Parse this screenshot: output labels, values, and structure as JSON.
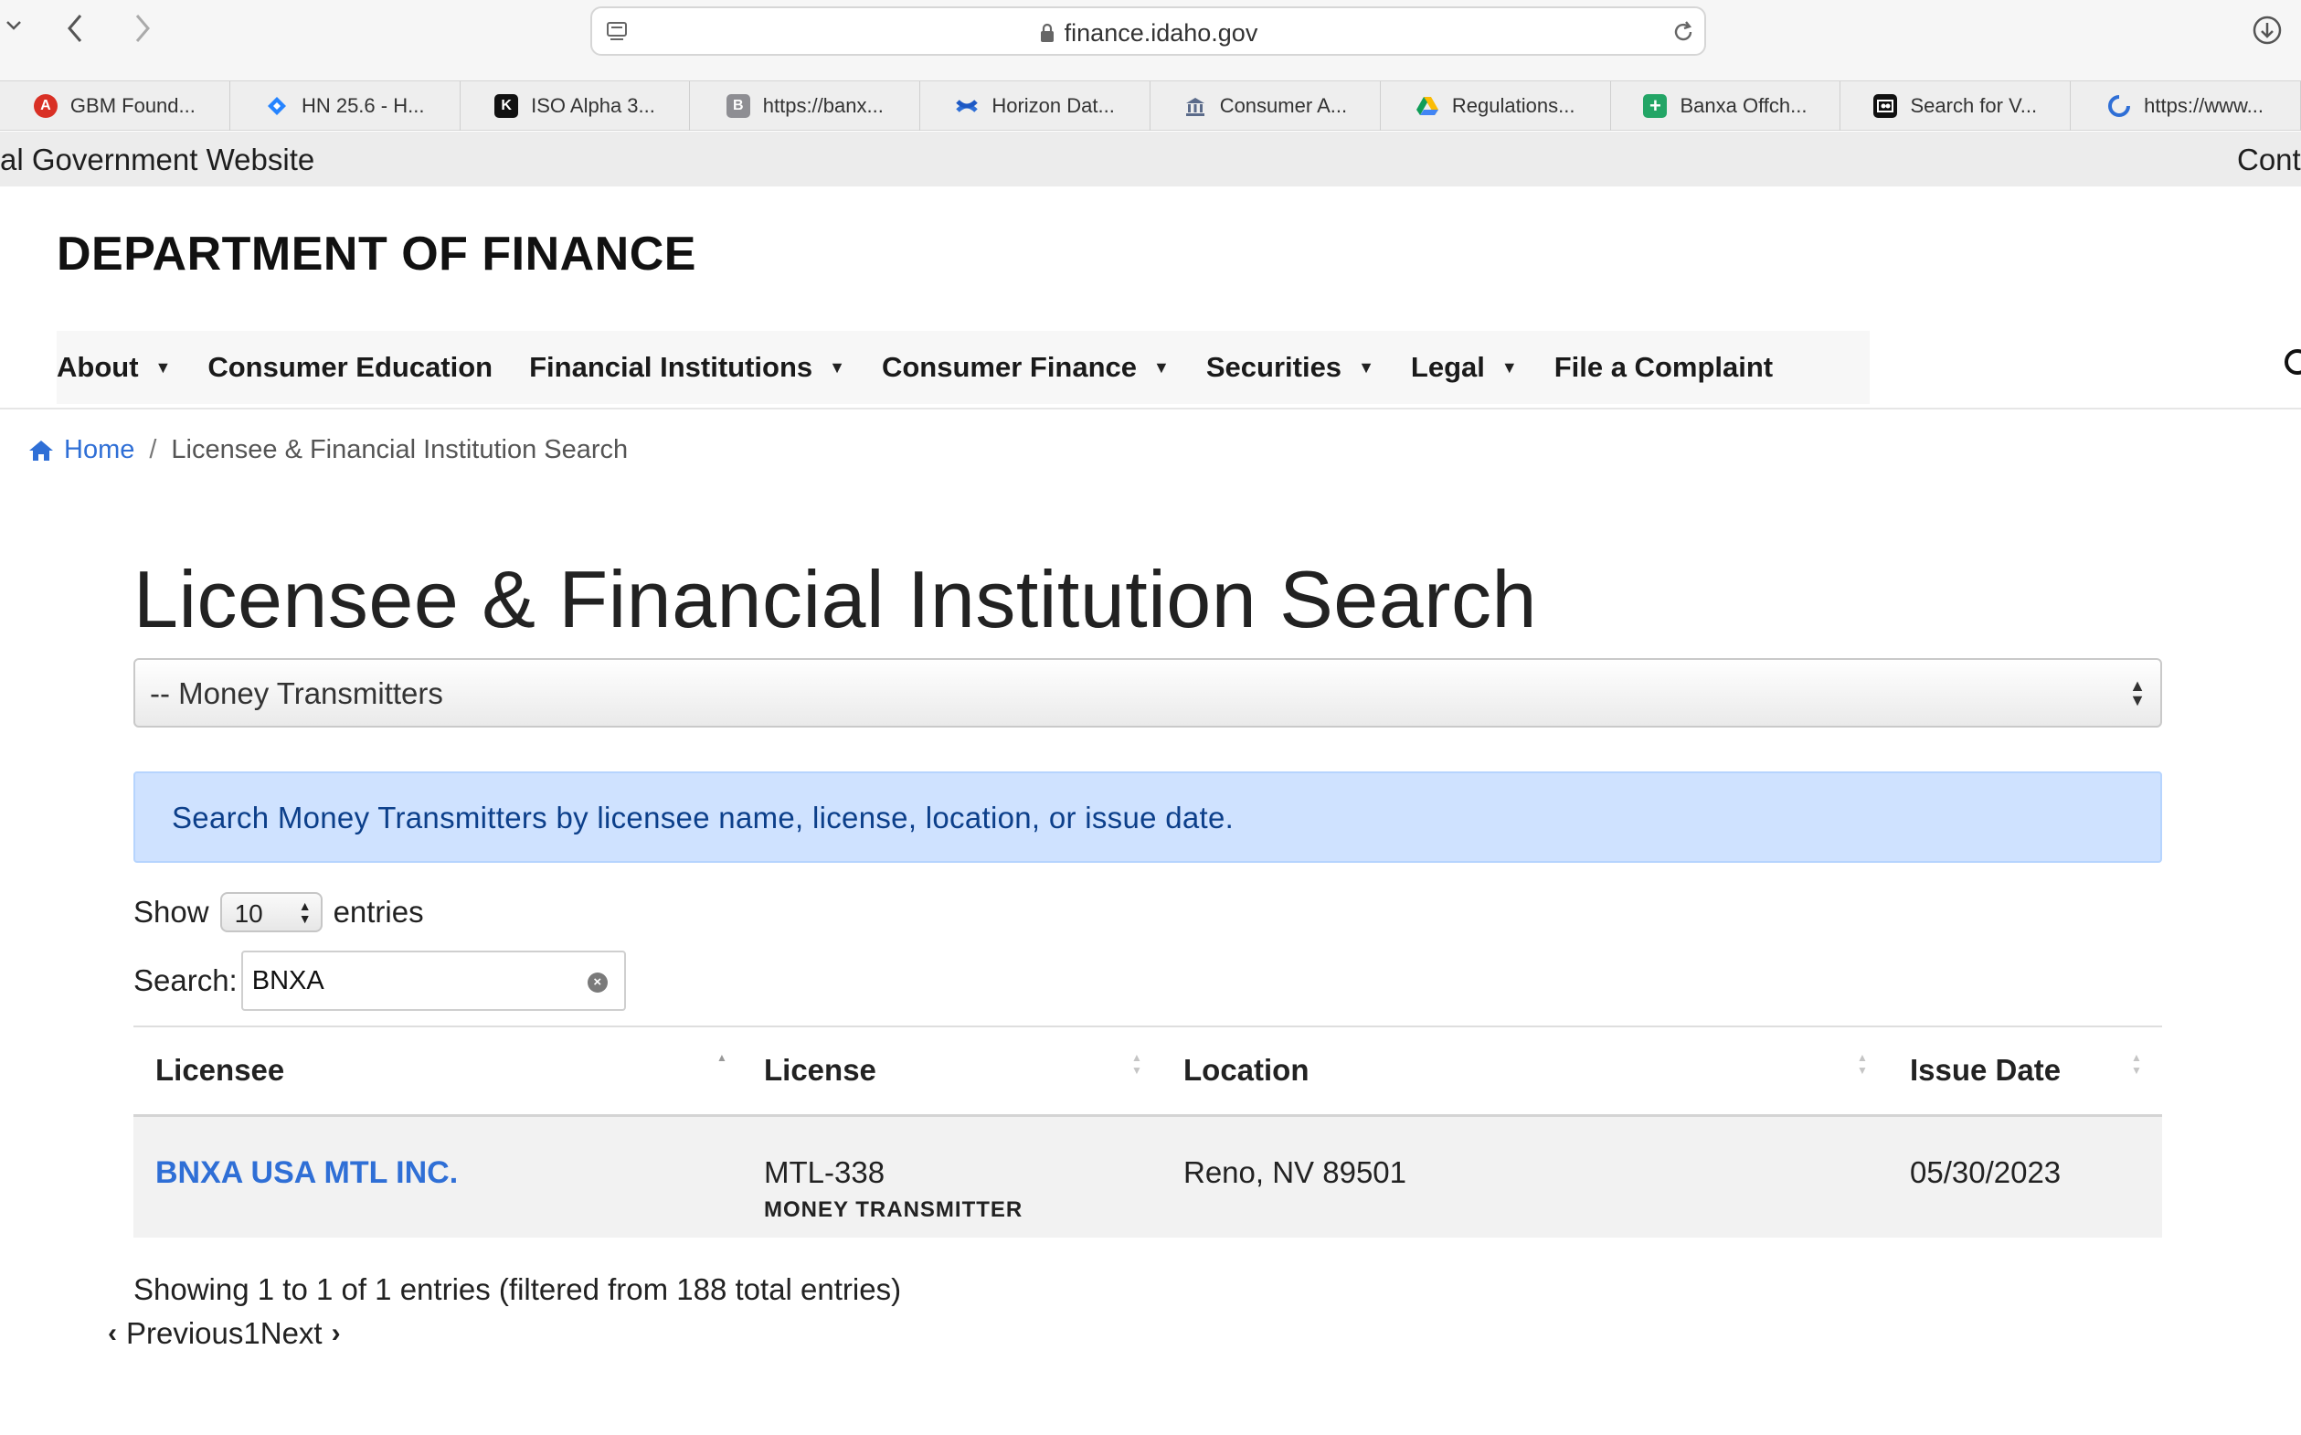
{
  "browser": {
    "url": "finance.idaho.gov",
    "bookmarks": [
      {
        "label": "GBM Found...",
        "icon": "gbm-icon",
        "color": "#d93025",
        "glyph": "A"
      },
      {
        "label": "HN 25.6 - H...",
        "icon": "jira-icon",
        "color": "#2684ff",
        "glyph": ""
      },
      {
        "label": "ISO Alpha 3...",
        "icon": "iso-icon",
        "color": "#111111",
        "glyph": "K"
      },
      {
        "label": "https://banx...",
        "icon": "letter-b-icon",
        "color": "#8e8e93",
        "glyph": "B"
      },
      {
        "label": "Horizon Dat...",
        "icon": "confluence-icon",
        "color": "#2f6fd6",
        "glyph": ""
      },
      {
        "label": "Consumer A...",
        "icon": "bank-icon",
        "color": "#5b6b8a",
        "glyph": ""
      },
      {
        "label": "Regulations...",
        "icon": "drive-icon",
        "color": "#fbbc04",
        "glyph": ""
      },
      {
        "label": "Banxa Offch...",
        "icon": "sheets-icon",
        "color": "#23a566",
        "glyph": "+"
      },
      {
        "label": "Search for V...",
        "icon": "search-site-icon",
        "color": "#111111",
        "glyph": ""
      },
      {
        "label": "https://www...",
        "icon": "loading-icon",
        "color": "#2f6fd6",
        "glyph": ""
      }
    ]
  },
  "gov_banner": {
    "left_text": "al Government Website",
    "right_text": "Cont"
  },
  "header": {
    "site_title": "DEPARTMENT OF FINANCE"
  },
  "nav": {
    "items": [
      {
        "label": "About",
        "has_caret": true
      },
      {
        "label": "Consumer Education",
        "has_caret": false
      },
      {
        "label": "Financial Institutions",
        "has_caret": true
      },
      {
        "label": "Consumer Finance",
        "has_caret": true
      },
      {
        "label": "Securities",
        "has_caret": true
      },
      {
        "label": "Legal",
        "has_caret": true
      },
      {
        "label": "File a Complaint",
        "has_caret": false
      }
    ]
  },
  "breadcrumb": {
    "home": "Home",
    "separator": "/",
    "current": "Licensee & Financial Institution Search"
  },
  "page": {
    "title": "Licensee & Financial Institution Search",
    "category_select": "-- Money Transmitters",
    "info_text": "Search Money Transmitters by licensee name, license, location, or issue date."
  },
  "datatable": {
    "show_label": "Show",
    "length_value": "10",
    "entries_label": "entries",
    "search_label": "Search:",
    "search_value": "BNXA",
    "columns": [
      "Licensee",
      "License",
      "Location",
      "Issue Date"
    ],
    "rows": [
      {
        "licensee": "BNXA USA MTL INC.",
        "license": "MTL-338",
        "license_type": "MONEY TRANSMITTER",
        "location": "Reno, NV 89501",
        "issue_date": "05/30/2023"
      }
    ],
    "info": "Showing 1 to 1 of 1 entries (filtered from 188 total entries)",
    "previous": "Previous",
    "page": "1",
    "next": "Next"
  }
}
